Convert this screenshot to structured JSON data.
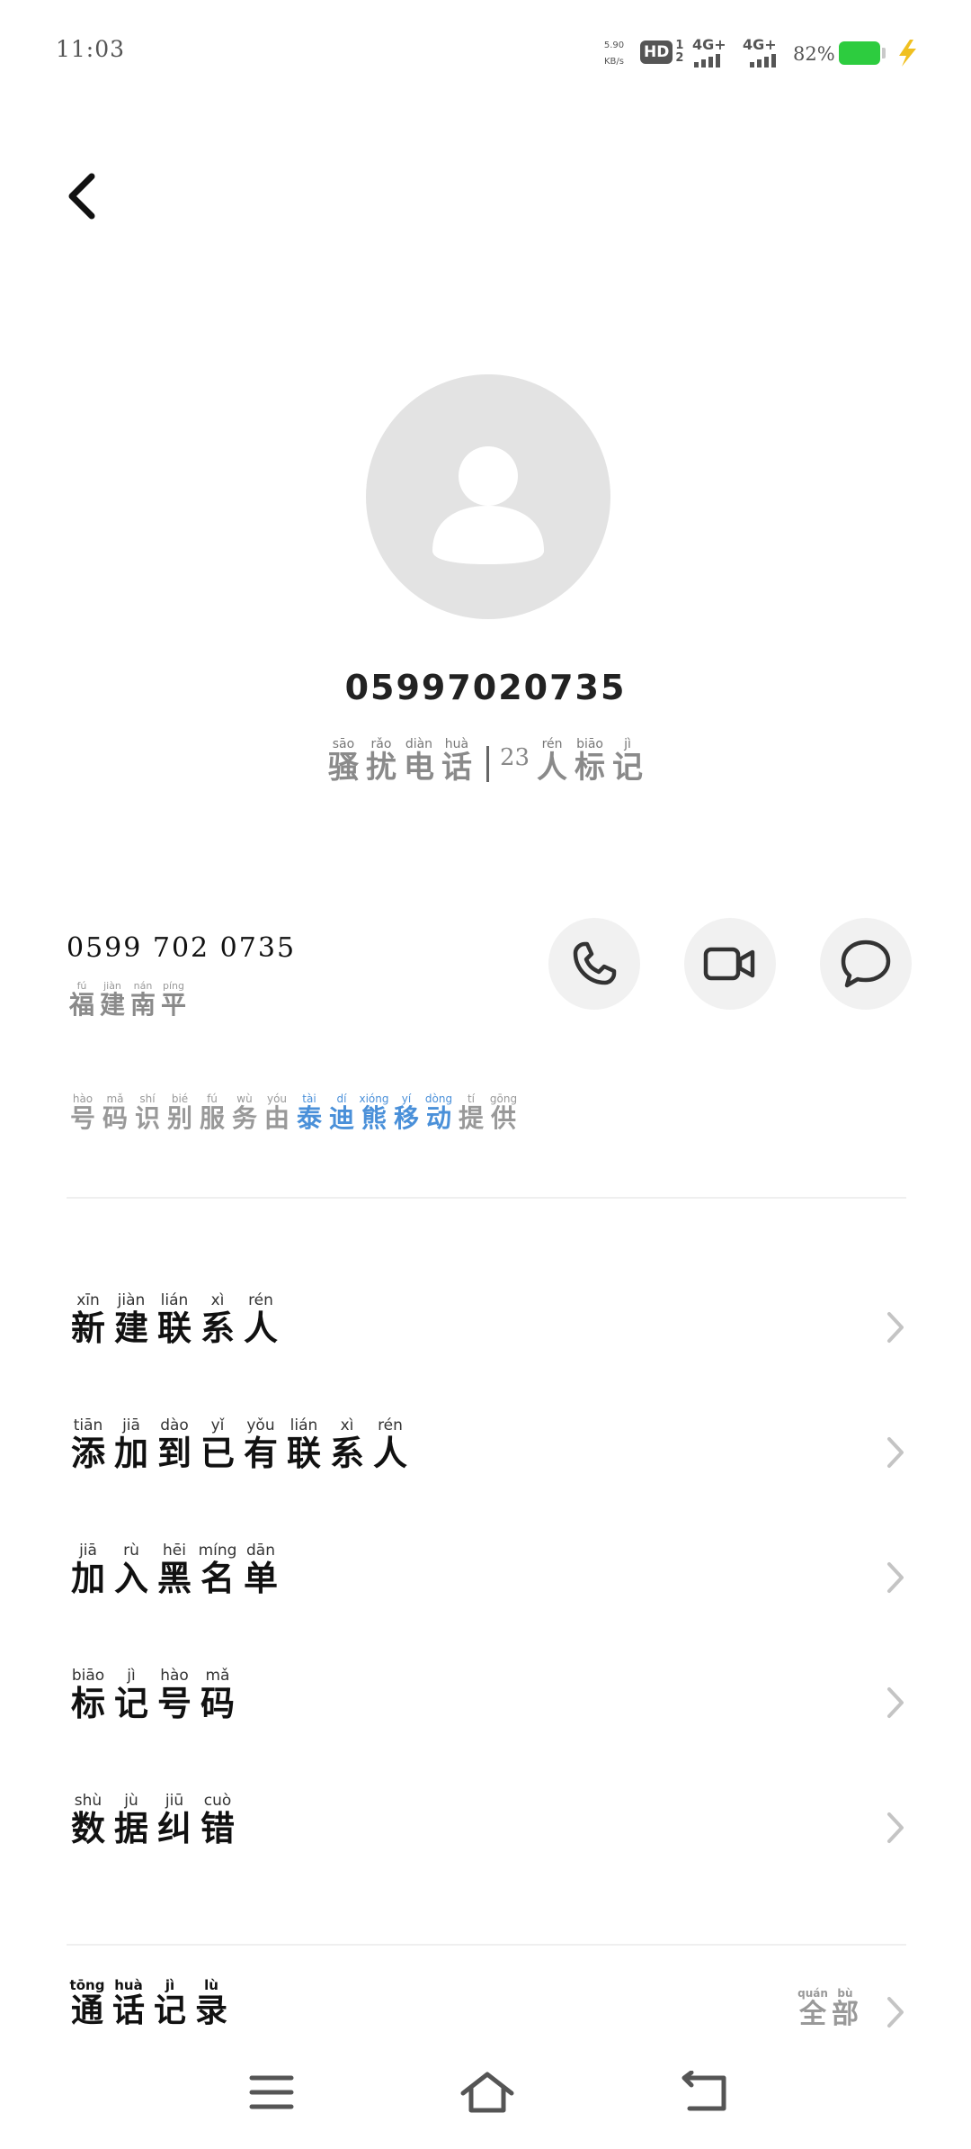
{
  "status_bar": {
    "time": "11:03",
    "net_speed_value": "5.90",
    "net_speed_unit": "KB/s",
    "hd_label": "HD",
    "sim_slots": "1\n2",
    "sim1_network": "4G+",
    "sim2_network": "4G+",
    "battery_percent": "82%",
    "battery_level": 0.82,
    "battery_color": "#2dcc3f",
    "charging_color": "#f0c020"
  },
  "header": {
    "back_icon": "chevron-left-icon"
  },
  "contact": {
    "avatar_icon": "person-placeholder-icon",
    "number_title": "05997020735",
    "spam_tag": [
      {
        "py": "sāo",
        "hz": "骚"
      },
      {
        "py": "rǎo",
        "hz": "扰"
      },
      {
        "py": "diàn",
        "hz": "电"
      },
      {
        "py": "huà",
        "hz": "话"
      }
    ],
    "mark_count": "23",
    "marked_by": [
      {
        "py": "rén",
        "hz": "人"
      },
      {
        "py": "biāo",
        "hz": "标"
      },
      {
        "py": "jì",
        "hz": "记"
      }
    ]
  },
  "number_row": {
    "formatted_number": "0599 702 0735",
    "location": [
      {
        "py": "fú",
        "hz": "福"
      },
      {
        "py": "jiàn",
        "hz": "建"
      },
      {
        "py": "nán",
        "hz": "南"
      },
      {
        "py": "píng",
        "hz": "平"
      }
    ],
    "actions": [
      {
        "name": "call-button",
        "icon": "phone-icon"
      },
      {
        "name": "video-call-button",
        "icon": "video-camera-icon"
      },
      {
        "name": "message-button",
        "icon": "chat-bubble-icon"
      }
    ]
  },
  "provider": {
    "prefix": [
      {
        "py": "hào",
        "hz": "号"
      },
      {
        "py": "mǎ",
        "hz": "码"
      },
      {
        "py": "shí",
        "hz": "识"
      },
      {
        "py": "bié",
        "hz": "别"
      },
      {
        "py": "fú",
        "hz": "服"
      },
      {
        "py": "wù",
        "hz": "务"
      },
      {
        "py": "yóu",
        "hz": "由"
      }
    ],
    "name": [
      {
        "py": "tài",
        "hz": "泰"
      },
      {
        "py": "dí",
        "hz": "迪"
      },
      {
        "py": "xióng",
        "hz": "熊"
      },
      {
        "py": "yí",
        "hz": "移"
      },
      {
        "py": "dòng",
        "hz": "动"
      }
    ],
    "suffix": [
      {
        "py": "tí",
        "hz": "提"
      },
      {
        "py": "gōng",
        "hz": "供"
      }
    ],
    "accent_color": "#4a90d9"
  },
  "menu": {
    "items": [
      {
        "name": "menu-new-contact",
        "chars": [
          {
            "py": "xīn",
            "hz": "新"
          },
          {
            "py": "jiàn",
            "hz": "建"
          },
          {
            "py": "lián",
            "hz": "联"
          },
          {
            "py": "xì",
            "hz": "系"
          },
          {
            "py": "rén",
            "hz": "人"
          }
        ]
      },
      {
        "name": "menu-add-to-existing-contact",
        "chars": [
          {
            "py": "tiān",
            "hz": "添"
          },
          {
            "py": "jiā",
            "hz": "加"
          },
          {
            "py": "dào",
            "hz": "到"
          },
          {
            "py": "yǐ",
            "hz": "已"
          },
          {
            "py": "yǒu",
            "hz": "有"
          },
          {
            "py": "lián",
            "hz": "联"
          },
          {
            "py": "xì",
            "hz": "系"
          },
          {
            "py": "rén",
            "hz": "人"
          }
        ]
      },
      {
        "name": "menu-add-to-blacklist",
        "chars": [
          {
            "py": "jiā",
            "hz": "加"
          },
          {
            "py": "rù",
            "hz": "入"
          },
          {
            "py": "hēi",
            "hz": "黑"
          },
          {
            "py": "míng",
            "hz": "名"
          },
          {
            "py": "dān",
            "hz": "单"
          }
        ]
      },
      {
        "name": "menu-mark-number",
        "chars": [
          {
            "py": "biāo",
            "hz": "标"
          },
          {
            "py": "jì",
            "hz": "记"
          },
          {
            "py": "hào",
            "hz": "号"
          },
          {
            "py": "mǎ",
            "hz": "码"
          }
        ]
      },
      {
        "name": "menu-data-correction",
        "chars": [
          {
            "py": "shù",
            "hz": "数"
          },
          {
            "py": "jù",
            "hz": "据"
          },
          {
            "py": "jiū",
            "hz": "纠"
          },
          {
            "py": "cuò",
            "hz": "错"
          }
        ]
      }
    ]
  },
  "call_log": {
    "title": [
      {
        "py": "tōng",
        "hz": "通"
      },
      {
        "py": "huà",
        "hz": "话"
      },
      {
        "py": "jì",
        "hz": "记"
      },
      {
        "py": "lù",
        "hz": "录"
      }
    ],
    "filter": [
      {
        "py": "quán",
        "hz": "全"
      },
      {
        "py": "bù",
        "hz": "部"
      }
    ]
  },
  "nav_bar": {
    "menu_icon": "hamburger-menu-icon",
    "home_icon": "home-icon",
    "back_icon": "back-arrow-icon"
  }
}
